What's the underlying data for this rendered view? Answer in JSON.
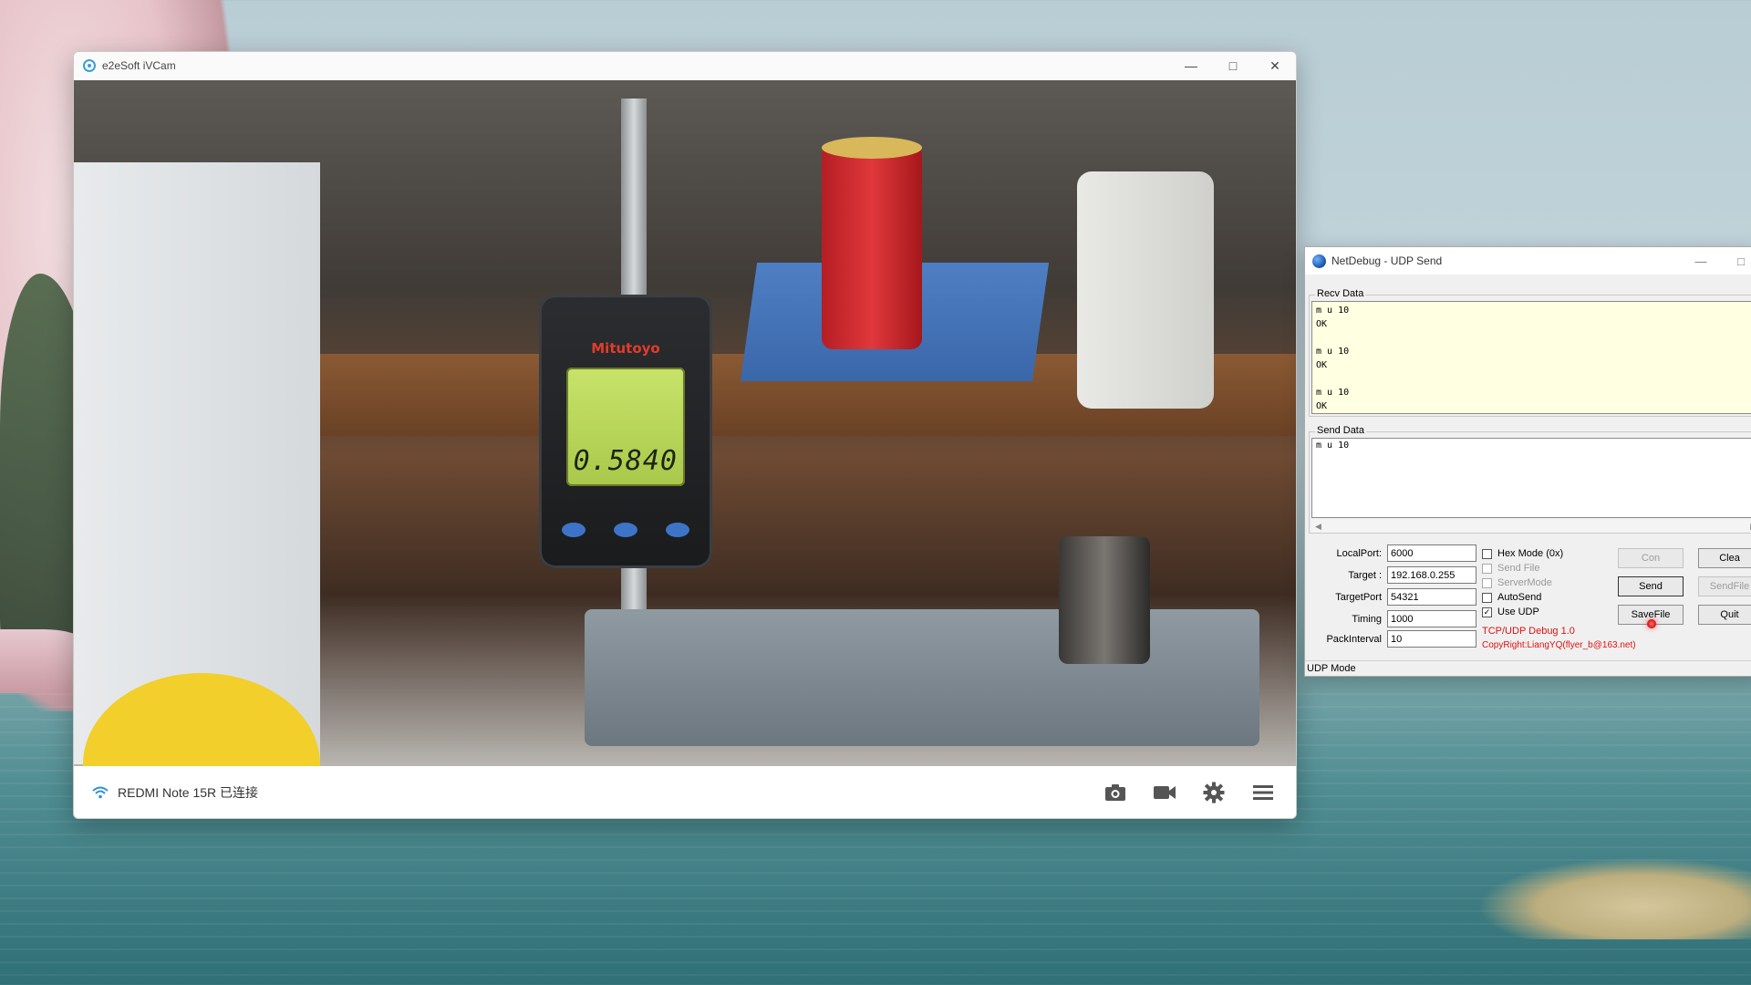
{
  "ivcam": {
    "title": "e2eSoft iVCam",
    "status": "REDMI Note 15R 已连接",
    "gauge_brand": "Mitutoyo",
    "gauge_reading": "0.5840",
    "footer_icons": [
      "camera-icon",
      "video-camera-icon",
      "gear-icon",
      "menu-icon"
    ]
  },
  "netdebug": {
    "title": "NetDebug - UDP Send",
    "recv_label": "Recv Data",
    "recv_text": "m u 10\nOK\n\nm u 10\nOK\n\nm u 10\nOK",
    "send_label": "Send Data",
    "send_text": "m u 10",
    "fields": {
      "localport_label": "LocalPort:",
      "localport_value": "6000",
      "target_label": "Target :",
      "target_value": "192.168.0.255",
      "targetport_label": "TargetPort",
      "targetport_value": "54321",
      "timing_label": "Timing",
      "timing_value": "1000",
      "packinterval_label": "PackInterval",
      "packinterval_value": "10"
    },
    "checks": [
      {
        "label": "Hex Mode (0x)",
        "checked": false,
        "disabled": false
      },
      {
        "label": "Send File",
        "checked": false,
        "disabled": true
      },
      {
        "label": "ServerMode",
        "checked": false,
        "disabled": true
      },
      {
        "label": "AutoSend",
        "checked": false,
        "disabled": false
      },
      {
        "label": "Use UDP",
        "checked": true,
        "disabled": false
      }
    ],
    "version": "TCP/UDP Debug  1.0",
    "copyright": "CopyRight:LiangYQ(flyer_b@163.net)",
    "buttons": {
      "con": "Con",
      "clear": "Clea",
      "send": "Send",
      "sendfile": "SendFile",
      "savefile": "SaveFile",
      "quit": "Quit"
    },
    "status": "UDP Mode"
  }
}
